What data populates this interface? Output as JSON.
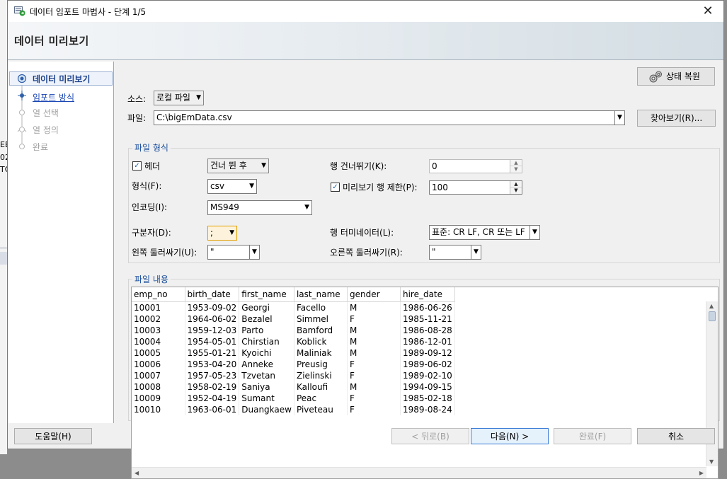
{
  "window": {
    "title": "데이터 임포트 마법사 - 단계 1/5",
    "close_glyph": "✕"
  },
  "background_text": [
    "EE",
    "02",
    "TO"
  ],
  "header": {
    "title": "데이터 미리보기"
  },
  "nav": {
    "items": [
      {
        "label": "데이터 미리보기",
        "state": "active"
      },
      {
        "label": "임포트 방식",
        "state": "link"
      },
      {
        "label": "열 선택",
        "state": "disabled"
      },
      {
        "label": "열 정의",
        "state": "disabled"
      },
      {
        "label": "완료",
        "state": "disabled"
      }
    ]
  },
  "restore_button": {
    "label": "상태 복원"
  },
  "source": {
    "label": "소스:",
    "value": "로컬 파일"
  },
  "file": {
    "label": "파일:",
    "value": "C:\\bigEmData.csv",
    "browse_label": "찾아보기(R)..."
  },
  "file_format": {
    "group_title": "파일 형식",
    "header": {
      "label": "헤더",
      "checked": true,
      "value": "건너 뛴 후"
    },
    "skip_rows": {
      "label": "행 건너뛰기(K):",
      "value": "0"
    },
    "format": {
      "label": "형식(F):",
      "value": "csv"
    },
    "preview_limit": {
      "label": "미리보기 행 제한(P):",
      "checked": true,
      "value": "100"
    },
    "encoding": {
      "label": "인코딩(I):",
      "value": "MS949"
    },
    "delimiter": {
      "label": "구분자(D):",
      "value": ";"
    },
    "line_terminator": {
      "label": "행 터미네이터(L):",
      "value": "표준: CR LF, CR 또는 LF"
    },
    "left_enclosure": {
      "label": "왼쪽 둘러싸기(U):",
      "value": "\""
    },
    "right_enclosure": {
      "label": "오른쪽 둘러싸기(R):",
      "value": "\""
    }
  },
  "file_contents": {
    "group_title": "파일 내용",
    "columns": [
      "emp_no",
      "birth_date",
      "first_name",
      "last_name",
      "gender",
      "hire_date"
    ],
    "rows": [
      [
        "10001",
        "1953-09-02",
        "Georgi",
        "Facello",
        "M",
        "1986-06-26"
      ],
      [
        "10002",
        "1964-06-02",
        "Bezalel",
        "Simmel",
        "F",
        "1985-11-21"
      ],
      [
        "10003",
        "1959-12-03",
        "Parto",
        "Bamford",
        "M",
        "1986-08-28"
      ],
      [
        "10004",
        "1954-05-01",
        "Chirstian",
        "Koblick",
        "M",
        "1986-12-01"
      ],
      [
        "10005",
        "1955-01-21",
        "Kyoichi",
        "Maliniak",
        "M",
        "1989-09-12"
      ],
      [
        "10006",
        "1953-04-20",
        "Anneke",
        "Preusig",
        "F",
        "1989-06-02"
      ],
      [
        "10007",
        "1957-05-23",
        "Tzvetan",
        "Zielinski",
        "F",
        "1989-02-10"
      ],
      [
        "10008",
        "1958-02-19",
        "Saniya",
        "Kalloufi",
        "M",
        "1994-09-15"
      ],
      [
        "10009",
        "1952-04-19",
        "Sumant",
        "Peac",
        "F",
        "1985-02-18"
      ],
      [
        "10010",
        "1963-06-01",
        "Duangkaew",
        "Piveteau",
        "F",
        "1989-08-24"
      ]
    ]
  },
  "buttons": {
    "help": "도움말(H)",
    "back": "< 뒤로(B)",
    "next": "다음(N) >",
    "finish": "완료(F)",
    "cancel": "취소"
  }
}
